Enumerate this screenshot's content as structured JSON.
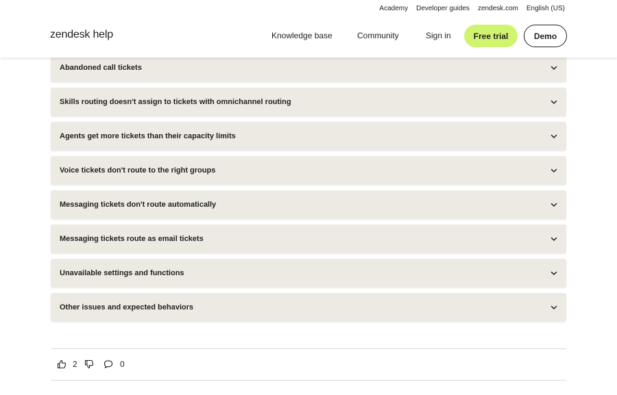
{
  "utility_nav": [
    "Academy",
    "Developer guides",
    "zendesk.com",
    "English (US)"
  ],
  "logo": "zendesk help",
  "main_nav": {
    "knowledge_base": "Knowledge base",
    "community": "Community",
    "sign_in": "Sign in",
    "free_trial": "Free trial",
    "demo": "Demo"
  },
  "accordion_items": [
    "Abandoned call tickets",
    "Skills routing doesn't assign to tickets with omnichannel routing",
    "Agents get more tickets than their capacity limits",
    "Voice tickets don't route to the right groups",
    "Messaging tickets don't route automatically",
    "Messaging tickets route as email tickets",
    "Unavailable settings and functions",
    "Other issues and expected behaviors"
  ],
  "feedback": {
    "upvotes": "2",
    "comments": "0"
  },
  "icons": {
    "accordion": "chevron-down-icon",
    "upvote": "thumbs-up-icon",
    "downvote": "thumbs-down-icon",
    "comments": "comment-icon"
  },
  "colors": {
    "free_trial_bg": "#d1f470",
    "accordion_bg": "#edeae3",
    "text": "#1f1f1f"
  }
}
